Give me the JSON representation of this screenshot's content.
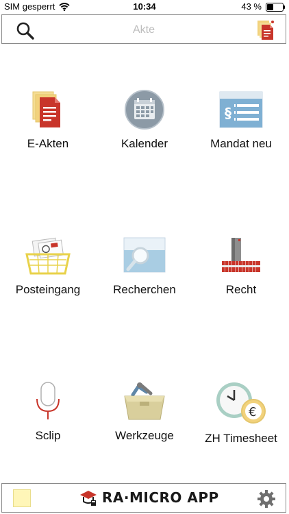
{
  "status": {
    "carrier": "SIM gesperrt",
    "time": "10:34",
    "battery_percent": "43 %",
    "battery_level": 0.43
  },
  "search": {
    "placeholder": "Akte"
  },
  "tiles": [
    {
      "label": "E-Akten",
      "icon": "e-akten-icon"
    },
    {
      "label": "Kalender",
      "icon": "calendar-icon"
    },
    {
      "label": "Mandat neu",
      "icon": "mandate-form-icon"
    },
    {
      "label": "Posteingang",
      "icon": "inbox-basket-icon"
    },
    {
      "label": "Recherchen",
      "icon": "research-magnifier-icon"
    },
    {
      "label": "Recht",
      "icon": "law-books-icon"
    },
    {
      "label": "Sclip",
      "icon": "microphone-icon"
    },
    {
      "label": "Werkzeuge",
      "icon": "toolbox-icon"
    },
    {
      "label": "ZH Timesheet",
      "icon": "clock-euro-icon"
    }
  ],
  "footer": {
    "brand": "RA·MICRO APP"
  },
  "colors": {
    "accent_red": "#c8352a",
    "folder_yellow": "#f2d27c",
    "calendar_grey": "#8c9aa6",
    "icon_blue": "#7fb0d3"
  }
}
